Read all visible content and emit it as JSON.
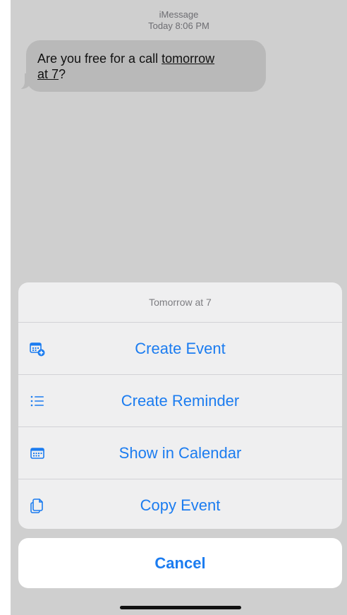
{
  "thread": {
    "service": "iMessage",
    "timestamp": "Today 8:06 PM"
  },
  "message": {
    "text_before": "Are you free for a call ",
    "link_text_1": "tomorrow",
    "link_text_2": "at 7",
    "text_after": "?"
  },
  "sheet": {
    "title": "Tomorrow at 7",
    "actions": [
      {
        "label": "Create Event",
        "icon": "calendar-add-icon"
      },
      {
        "label": "Create Reminder",
        "icon": "list-icon"
      },
      {
        "label": "Show in Calendar",
        "icon": "calendar-icon"
      },
      {
        "label": "Copy Event",
        "icon": "copy-icon"
      }
    ],
    "cancel_label": "Cancel"
  },
  "colors": {
    "accent": "#1b7cf0",
    "dimmed_background": "#cfcfcf",
    "bubble": "#b9b9b9"
  }
}
